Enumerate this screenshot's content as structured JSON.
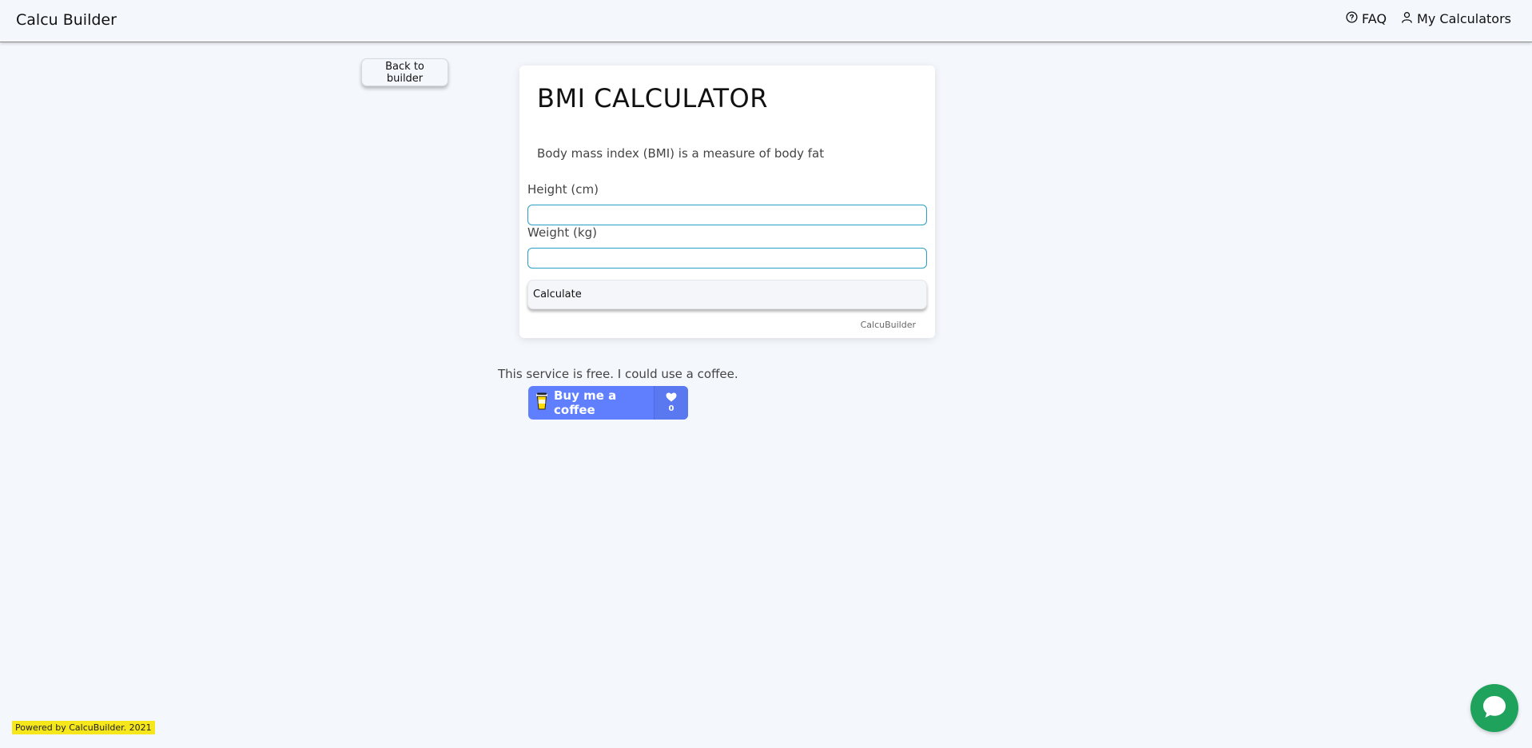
{
  "navbar": {
    "brand": "Calcu Builder",
    "faq_label": "FAQ",
    "my_calculators_label": "My Calculators"
  },
  "back_button_label": "Back to builder",
  "calculator": {
    "title": "BMI CALCULATOR",
    "description": "Body mass index (BMI) is a measure of body fat",
    "fields": [
      {
        "label": "Height (cm)",
        "value": "",
        "placeholder": ""
      },
      {
        "label": "Weight (kg)",
        "value": "",
        "placeholder": ""
      }
    ],
    "calculate_label": "Calculate",
    "footer": "CalcuBuilder"
  },
  "coffee": {
    "text": "This service is free. I could use a coffee.",
    "button_label": "Buy me a coffee",
    "count": "0"
  },
  "powered_by": "Powered by CalcuBuilder. 2021",
  "colors": {
    "background": "#f4f7fc",
    "input_border": "#2a9fc4",
    "coffee_button": "#5f7fff",
    "powered_highlight": "#f5e71b",
    "chat_bubble": "#1fa35c"
  },
  "icons": {
    "faq": "question-circle-icon",
    "user": "user-icon",
    "coffee": "coffee-cup-icon",
    "heart": "heart-icon",
    "chat": "chat-bubble-icon"
  }
}
